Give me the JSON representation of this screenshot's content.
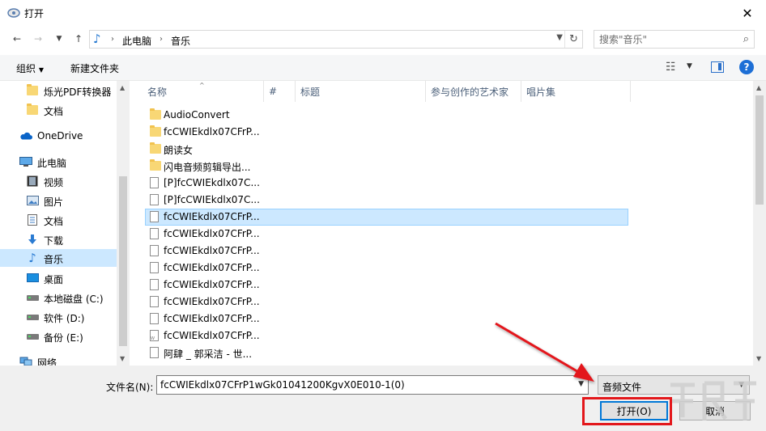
{
  "window": {
    "title": "打开"
  },
  "nav": {
    "breadcrumb": [
      "此电脑",
      "音乐"
    ],
    "search_placeholder": "搜索\"音乐\""
  },
  "toolbar": {
    "organize_label": "组织",
    "new_folder_label": "新建文件夹"
  },
  "sidebar": {
    "items": [
      {
        "label": "烁光PDF转换器",
        "icon": "folder-icon"
      },
      {
        "label": "文档",
        "icon": "folder-icon"
      },
      {
        "label": "OneDrive",
        "icon": "cloud-icon"
      },
      {
        "label": "此电脑",
        "icon": "computer-icon"
      },
      {
        "label": "视频",
        "icon": "video-icon"
      },
      {
        "label": "图片",
        "icon": "picture-icon"
      },
      {
        "label": "文档",
        "icon": "document-icon"
      },
      {
        "label": "下载",
        "icon": "download-icon"
      },
      {
        "label": "音乐",
        "icon": "music-icon",
        "selected": true
      },
      {
        "label": "桌面",
        "icon": "desktop-icon"
      },
      {
        "label": "本地磁盘 (C:)",
        "icon": "drive-icon"
      },
      {
        "label": "软件 (D:)",
        "icon": "drive-icon"
      },
      {
        "label": "备份 (E:)",
        "icon": "drive-icon"
      },
      {
        "label": "网络",
        "icon": "network-icon"
      }
    ]
  },
  "columns": [
    "名称",
    "#",
    "标题",
    "参与创作的艺术家",
    "唱片集"
  ],
  "files": [
    {
      "name": "AudioConvert",
      "type": "folder"
    },
    {
      "name": "fcCWIEkdlx07CFrP...",
      "type": "folder"
    },
    {
      "name": "朗读女",
      "type": "folder"
    },
    {
      "name": "闪电音频剪辑导出...",
      "type": "folder"
    },
    {
      "name": "[P]fcCWIEkdlx07C...",
      "type": "file"
    },
    {
      "name": "[P]fcCWIEkdlx07C...",
      "type": "file"
    },
    {
      "name": "fcCWIEkdlx07CFrP...",
      "type": "file",
      "selected": true
    },
    {
      "name": "fcCWIEkdlx07CFrP...",
      "type": "file"
    },
    {
      "name": "fcCWIEkdlx07CFrP...",
      "type": "file"
    },
    {
      "name": "fcCWIEkdlx07CFrP...",
      "type": "file"
    },
    {
      "name": "fcCWIEkdlx07CFrP...",
      "type": "file"
    },
    {
      "name": "fcCWIEkdlx07CFrP...",
      "type": "file"
    },
    {
      "name": "fcCWIEkdlx07CFrP...",
      "type": "file"
    },
    {
      "name": "fcCWIEkdlx07CFrP...",
      "type": "audio"
    },
    {
      "name": "阿肆 _ 郭采洁 - 世...",
      "type": "file"
    }
  ],
  "footer": {
    "filename_label": "文件名(N):",
    "filename_value": "fcCWIEkdlx07CFrP1wGk01041200KgvX0E010-1(0)",
    "filetype_value": "音频文件",
    "open_label": "打开(O)",
    "cancel_label": "取消"
  },
  "colors": {
    "selection": "#cce8ff",
    "accent": "#0078d7",
    "annotation": "#e3171b"
  }
}
